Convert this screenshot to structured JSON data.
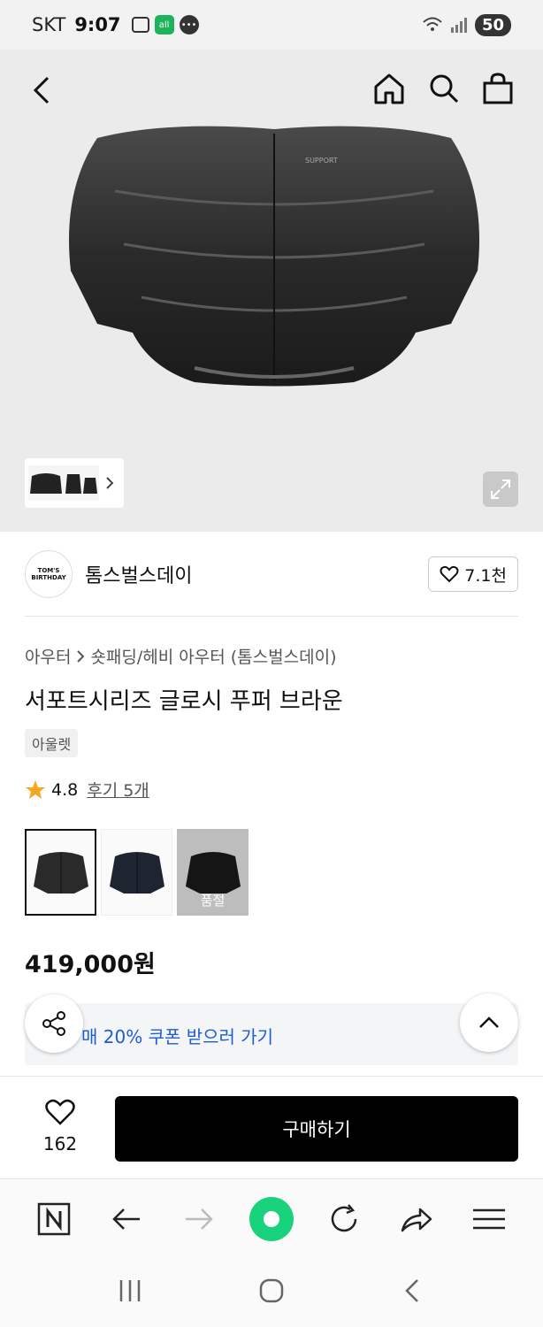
{
  "status_bar": {
    "carrier": "SKT",
    "time": "9:07",
    "battery": "50"
  },
  "header": {
    "back_icon": "chevron-left-icon",
    "home_icon": "home-icon",
    "search_icon": "search-icon",
    "bag_icon": "shopping-bag-icon"
  },
  "brand": {
    "name": "톰스벌스데이",
    "logo_text": "TOM'S BIRTHDAY",
    "likes": "7.1천"
  },
  "product": {
    "breadcrumb": [
      "아우터",
      "숏패딩/헤비 아우터 (톰스벌스데이)"
    ],
    "title": "서포트시리즈 글로시 푸퍼 브라운",
    "badge": "아울렛",
    "rating": "4.8",
    "review_link": "후기 5개",
    "variants": [
      {
        "status": "selected"
      },
      {
        "status": "available"
      },
      {
        "status": "soldout",
        "label": "품절"
      }
    ],
    "price": "419,000원"
  },
  "coupon": {
    "text": "매 20% 쿠폰 받으러 가기"
  },
  "buy_bar": {
    "wish_count": "162",
    "buy_label": "구매하기"
  },
  "colors": {
    "accent_blue": "#1f5bd6",
    "browser_green": "#19d27c",
    "star": "#f5a623"
  }
}
